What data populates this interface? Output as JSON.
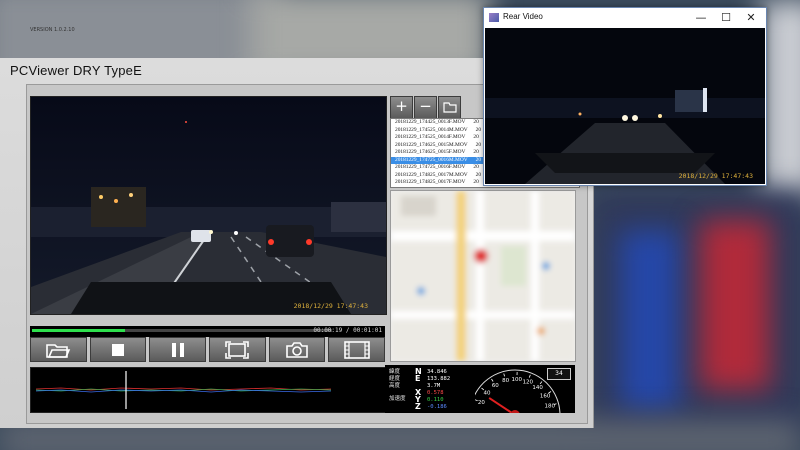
{
  "app": {
    "title": "PCViewer  DRY TypeE",
    "version": "VERSION 1.0.2.10"
  },
  "main_video": {
    "timestamp": "2018/12/29 17:47:43"
  },
  "playback": {
    "progress_fraction": 0.31,
    "time": "00:00:19 / 00:01:01"
  },
  "controls": [
    {
      "name": "open-folder-button",
      "icon": "folder-icon"
    },
    {
      "name": "stop-button",
      "icon": "stop-icon"
    },
    {
      "name": "pause-button",
      "icon": "pause-icon"
    },
    {
      "name": "fullscreen-button",
      "icon": "fullscreen-icon"
    },
    {
      "name": "snapshot-button",
      "icon": "camera-icon"
    },
    {
      "name": "film-button",
      "icon": "film-icon"
    }
  ],
  "file_buttons": {
    "add": "+",
    "remove": "−"
  },
  "files": [
    {
      "name": "20181229_174425_0013F.MOV",
      "extra": "20",
      "selected": false
    },
    {
      "name": "20181229_174525_0014M.MOV",
      "extra": "20",
      "selected": false
    },
    {
      "name": "20181229_174525_0014F.MOV",
      "extra": "20",
      "selected": false
    },
    {
      "name": "20181229_174625_0015M.MOV",
      "extra": "20",
      "selected": false
    },
    {
      "name": "20181229_174625_0015F.MOV",
      "extra": "20",
      "selected": false
    },
    {
      "name": "20181229_174725_0016M.MOV",
      "extra": "20",
      "selected": true
    },
    {
      "name": "20181229_174725_0016F.MOV",
      "extra": "20",
      "selected": false
    },
    {
      "name": "20181229_174825_0017M.MOV",
      "extra": "20",
      "selected": false
    },
    {
      "name": "20181229_174825_0017F.MOV",
      "extra": "20",
      "selected": false
    }
  ],
  "gps": {
    "lat_label": "緯度",
    "lat_dir": "N",
    "lat_value": "34.846",
    "lon_label": "経度",
    "lon_dir": "E",
    "lon_value": "133.882",
    "alt_label": "高度",
    "alt_value": "3.7M",
    "accel_label": "加速度",
    "x_axis": "X",
    "x_value": "0.578",
    "y_axis": "Y",
    "y_value": "0.110",
    "z_axis": "Z",
    "z_value": "-0.186"
  },
  "speedometer": {
    "speed": "34",
    "ticks": [
      "20",
      "40",
      "60",
      "80",
      "100",
      "120",
      "140",
      "160",
      "180"
    ],
    "needle_value": 34
  },
  "rear_window": {
    "title": "Rear Video",
    "timestamp": "2018/12/29 17:47:43",
    "minimize": "—",
    "maximize": "☐",
    "close": "✕"
  },
  "colors": {
    "selection": "#3a8ee6",
    "progress": "#2ee04d",
    "timestamp": "#e0b23c"
  }
}
